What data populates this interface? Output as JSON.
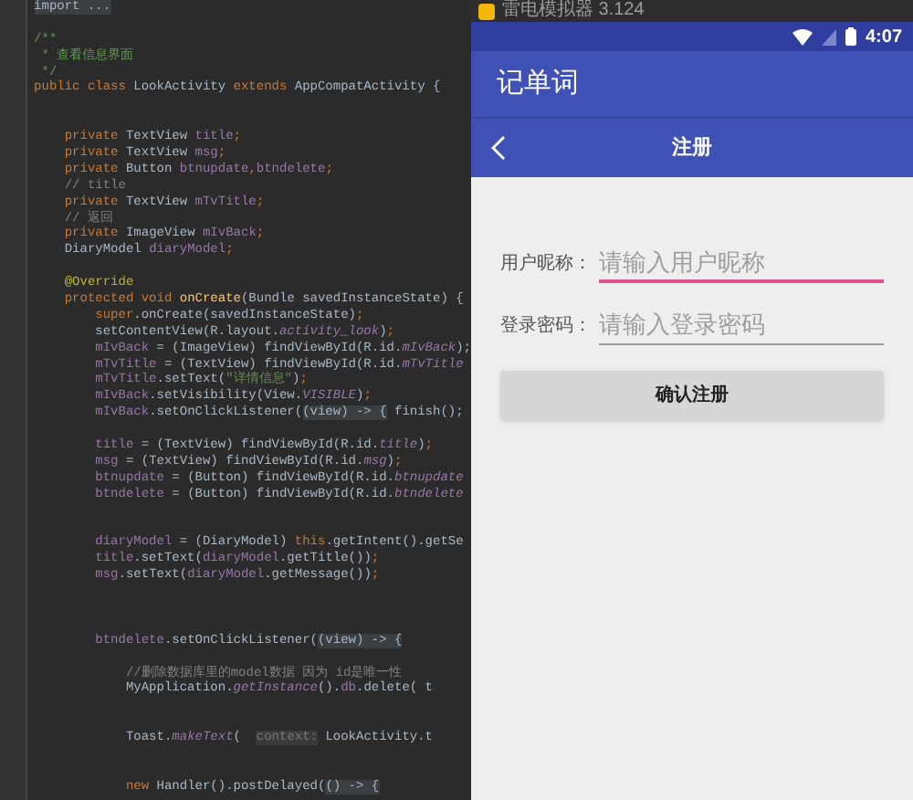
{
  "editor": {
    "lines": [
      {
        "kind": "code",
        "tokens": [
          {
            "kind": "fold",
            "text": "import ..."
          }
        ]
      },
      {
        "kind": "blank"
      },
      {
        "kind": "code",
        "tokens": [
          {
            "kind": "doc",
            "text": "/**"
          }
        ]
      },
      {
        "kind": "code",
        "tokens": [
          {
            "kind": "doc",
            "text": " * 查看信息界面"
          }
        ]
      },
      {
        "kind": "code",
        "tokens": [
          {
            "kind": "doc",
            "text": " */"
          }
        ]
      },
      {
        "kind": "code",
        "tokens": [
          {
            "kind": "kw",
            "text": "public class "
          },
          {
            "kind": "plain",
            "text": "LookActivity "
          },
          {
            "kind": "kw",
            "text": "extends "
          },
          {
            "kind": "plain",
            "text": "AppCompatActivity {"
          }
        ]
      },
      {
        "kind": "blank"
      },
      {
        "kind": "blank"
      },
      {
        "kind": "code",
        "tokens": [
          {
            "kind": "kw",
            "text": "    private "
          },
          {
            "kind": "plain",
            "text": "TextView "
          },
          {
            "kind": "field",
            "text": "title"
          },
          {
            "kind": "kw",
            "text": ";"
          }
        ]
      },
      {
        "kind": "code",
        "tokens": [
          {
            "kind": "kw",
            "text": "    private "
          },
          {
            "kind": "plain",
            "text": "TextView "
          },
          {
            "kind": "field",
            "text": "msg"
          },
          {
            "kind": "kw",
            "text": ";"
          }
        ]
      },
      {
        "kind": "code",
        "tokens": [
          {
            "kind": "kw",
            "text": "    private "
          },
          {
            "kind": "plain",
            "text": "Button "
          },
          {
            "kind": "field",
            "text": "btnupdate"
          },
          {
            "kind": "kw",
            "text": ","
          },
          {
            "kind": "field",
            "text": "btndelete"
          },
          {
            "kind": "kw",
            "text": ";"
          }
        ]
      },
      {
        "kind": "code",
        "tokens": [
          {
            "kind": "comment",
            "text": "    // title"
          }
        ]
      },
      {
        "kind": "code",
        "tokens": [
          {
            "kind": "kw",
            "text": "    private "
          },
          {
            "kind": "plain",
            "text": "TextView "
          },
          {
            "kind": "field",
            "text": "mTvTitle"
          },
          {
            "kind": "kw",
            "text": ";"
          }
        ]
      },
      {
        "kind": "code",
        "tokens": [
          {
            "kind": "comment",
            "text": "    // 返回"
          }
        ]
      },
      {
        "kind": "code",
        "tokens": [
          {
            "kind": "kw",
            "text": "    private "
          },
          {
            "kind": "plain",
            "text": "ImageView "
          },
          {
            "kind": "field",
            "text": "mIvBack"
          },
          {
            "kind": "kw",
            "text": ";"
          }
        ]
      },
      {
        "kind": "code",
        "tokens": [
          {
            "kind": "plain",
            "text": "    DiaryModel "
          },
          {
            "kind": "field",
            "text": "diaryModel"
          },
          {
            "kind": "kw",
            "text": ";"
          }
        ]
      },
      {
        "kind": "blank"
      },
      {
        "kind": "code",
        "tokens": [
          {
            "kind": "annotation",
            "text": "    @Override"
          }
        ]
      },
      {
        "kind": "code",
        "tokens": [
          {
            "kind": "kw",
            "text": "    protected void "
          },
          {
            "kind": "method",
            "text": "onCreate"
          },
          {
            "kind": "plain",
            "text": "(Bundle savedInstanceState) {"
          }
        ]
      },
      {
        "kind": "code",
        "tokens": [
          {
            "kind": "kw",
            "text": "        super"
          },
          {
            "kind": "plain",
            "text": ".onCreate(savedInstanceState)"
          },
          {
            "kind": "kw",
            "text": ";"
          }
        ]
      },
      {
        "kind": "code",
        "tokens": [
          {
            "kind": "plain",
            "text": "        setContentView(R.layout."
          },
          {
            "kind": "static",
            "text": "activity_look"
          },
          {
            "kind": "plain",
            "text": ")"
          },
          {
            "kind": "kw",
            "text": ";"
          }
        ]
      },
      {
        "kind": "code",
        "tokens": [
          {
            "kind": "field",
            "text": "        mIvBack"
          },
          {
            "kind": "plain",
            "text": " = (ImageView) findViewById(R.id."
          },
          {
            "kind": "static",
            "text": "mIvBack"
          },
          {
            "kind": "plain",
            "text": ");"
          }
        ]
      },
      {
        "kind": "code",
        "tokens": [
          {
            "kind": "field",
            "text": "        mTvTitle"
          },
          {
            "kind": "plain",
            "text": " = (TextView) findViewById(R.id."
          },
          {
            "kind": "static",
            "text": "mTvTitle"
          }
        ]
      },
      {
        "kind": "code",
        "tokens": [
          {
            "kind": "field",
            "text": "        mTvTitle"
          },
          {
            "kind": "plain",
            "text": ".setText("
          },
          {
            "kind": "string",
            "text": "\"详情信息\""
          },
          {
            "kind": "plain",
            "text": ")"
          },
          {
            "kind": "kw",
            "text": ";"
          }
        ]
      },
      {
        "kind": "code",
        "tokens": [
          {
            "kind": "field",
            "text": "        mIvBack"
          },
          {
            "kind": "plain",
            "text": ".setVisibility(View."
          },
          {
            "kind": "static",
            "text": "VISIBLE"
          },
          {
            "kind": "plain",
            "text": ")"
          },
          {
            "kind": "kw",
            "text": ";"
          }
        ]
      },
      {
        "kind": "code",
        "tokens": [
          {
            "kind": "field",
            "text": "        mIvBack"
          },
          {
            "kind": "plain",
            "text": ".setOnClickListener("
          },
          {
            "kind": "fold",
            "text": "(view) -> {"
          },
          {
            "kind": "plain",
            "text": " finish();"
          }
        ]
      },
      {
        "kind": "blank"
      },
      {
        "kind": "code",
        "tokens": [
          {
            "kind": "field",
            "text": "        title"
          },
          {
            "kind": "plain",
            "text": " = (TextView) findViewById(R.id."
          },
          {
            "kind": "static",
            "text": "title"
          },
          {
            "kind": "plain",
            "text": ")"
          },
          {
            "kind": "kw",
            "text": ";"
          }
        ]
      },
      {
        "kind": "code",
        "tokens": [
          {
            "kind": "field",
            "text": "        msg"
          },
          {
            "kind": "plain",
            "text": " = (TextView) findViewById(R.id."
          },
          {
            "kind": "static",
            "text": "msg"
          },
          {
            "kind": "plain",
            "text": ")"
          },
          {
            "kind": "kw",
            "text": ";"
          }
        ]
      },
      {
        "kind": "code",
        "tokens": [
          {
            "kind": "field",
            "text": "        btnupdate"
          },
          {
            "kind": "plain",
            "text": " = (Button) findViewById(R.id."
          },
          {
            "kind": "static",
            "text": "btnupdate"
          }
        ]
      },
      {
        "kind": "code",
        "tokens": [
          {
            "kind": "field",
            "text": "        btndelete"
          },
          {
            "kind": "plain",
            "text": " = (Button) findViewById(R.id."
          },
          {
            "kind": "static",
            "text": "btndelete"
          }
        ]
      },
      {
        "kind": "blank"
      },
      {
        "kind": "blank"
      },
      {
        "kind": "code",
        "tokens": [
          {
            "kind": "field",
            "text": "        diaryModel"
          },
          {
            "kind": "plain",
            "text": " = (DiaryModel) "
          },
          {
            "kind": "kw",
            "text": "this"
          },
          {
            "kind": "plain",
            "text": ".getIntent().getSe"
          }
        ]
      },
      {
        "kind": "code",
        "tokens": [
          {
            "kind": "field",
            "text": "        title"
          },
          {
            "kind": "plain",
            "text": ".setText("
          },
          {
            "kind": "field",
            "text": "diaryModel"
          },
          {
            "kind": "plain",
            "text": ".getTitle())"
          },
          {
            "kind": "kw",
            "text": ";"
          }
        ]
      },
      {
        "kind": "code",
        "tokens": [
          {
            "kind": "field",
            "text": "        msg"
          },
          {
            "kind": "plain",
            "text": ".setText("
          },
          {
            "kind": "field",
            "text": "diaryModel"
          },
          {
            "kind": "plain",
            "text": ".getMessage())"
          },
          {
            "kind": "kw",
            "text": ";"
          }
        ]
      },
      {
        "kind": "blank"
      },
      {
        "kind": "blank"
      },
      {
        "kind": "blank"
      },
      {
        "kind": "code",
        "tokens": [
          {
            "kind": "field",
            "text": "        btndelete"
          },
          {
            "kind": "plain",
            "text": ".setOnClickListener("
          },
          {
            "kind": "fold",
            "text": "(view) -> {"
          }
        ]
      },
      {
        "kind": "blank"
      },
      {
        "kind": "code",
        "tokens": [
          {
            "kind": "comment",
            "text": "            //删除数据库里的model数据 因为 id是唯一性"
          }
        ]
      },
      {
        "kind": "code",
        "tokens": [
          {
            "kind": "plain",
            "text": "            MyApplication."
          },
          {
            "kind": "static",
            "text": "getInstance"
          },
          {
            "kind": "plain",
            "text": "()."
          },
          {
            "kind": "field",
            "text": "db"
          },
          {
            "kind": "plain",
            "text": ".delete( t"
          }
        ]
      },
      {
        "kind": "blank"
      },
      {
        "kind": "blank"
      },
      {
        "kind": "code",
        "tokens": [
          {
            "kind": "plain",
            "text": "            Toast."
          },
          {
            "kind": "static",
            "text": "makeText"
          },
          {
            "kind": "plain",
            "text": "(  "
          },
          {
            "kind": "hint",
            "text": "context:"
          },
          {
            "kind": "plain",
            "text": " LookActivity.t"
          }
        ]
      },
      {
        "kind": "blank"
      },
      {
        "kind": "blank"
      },
      {
        "kind": "code",
        "tokens": [
          {
            "kind": "kw",
            "text": "            new "
          },
          {
            "kind": "plain",
            "text": "Handler().postDelayed("
          },
          {
            "kind": "fold",
            "text": "() -> {"
          }
        ]
      }
    ]
  },
  "emulator": {
    "window_title": "雷电模拟器 3.124",
    "status_bar": {
      "time": "4:07"
    },
    "app_bar": {
      "title": "记单词"
    },
    "nav_bar": {
      "title": "注册"
    },
    "form": {
      "fields": [
        {
          "label": "用户昵称：",
          "placeholder": "请输入用户昵称",
          "focused": true
        },
        {
          "label": "登录密码：",
          "placeholder": "请输入登录密码",
          "focused": false
        }
      ],
      "button": "确认注册"
    }
  }
}
